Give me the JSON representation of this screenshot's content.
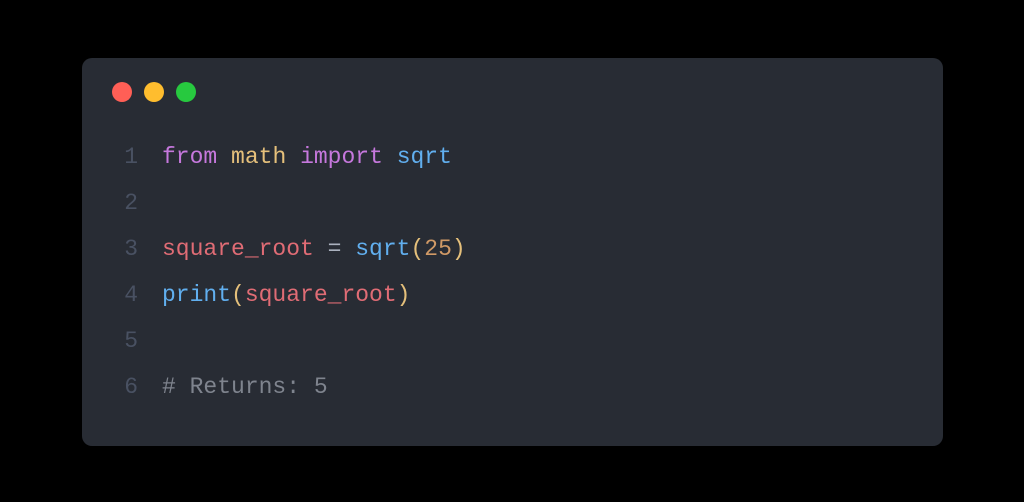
{
  "window": {
    "traffic_lights": {
      "red": "#ff5f56",
      "yellow": "#ffbd2e",
      "green": "#27c93f"
    }
  },
  "code": {
    "line_numbers": [
      "1",
      "2",
      "3",
      "4",
      "5",
      "6"
    ],
    "l1": {
      "kw_from": "from",
      "module": "math",
      "kw_import": "import",
      "fn": "sqrt"
    },
    "l3": {
      "var": "square_root",
      "eq": " = ",
      "fn": "sqrt",
      "lp": "(",
      "num": "25",
      "rp": ")"
    },
    "l4": {
      "fn": "print",
      "lp": "(",
      "var": "square_root",
      "rp": ")"
    },
    "l6": {
      "comment": "# Returns: 5"
    }
  }
}
